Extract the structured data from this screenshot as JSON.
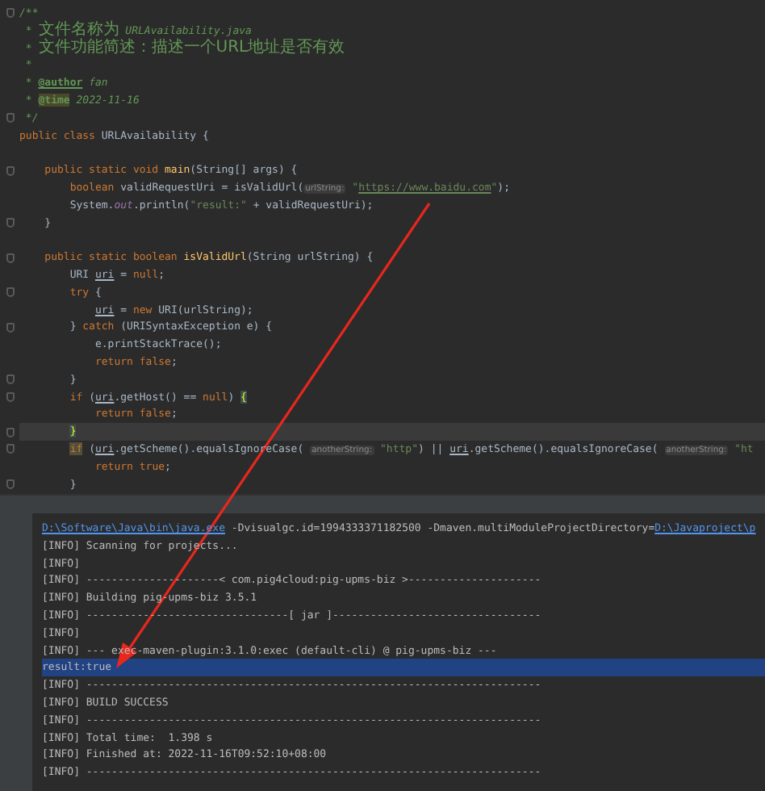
{
  "editor": {
    "lines": [
      {
        "kind": "code",
        "fold": true,
        "segments": [
          {
            "kind": "comment",
            "text": "/**"
          }
        ]
      },
      {
        "kind": "code",
        "segments": [
          {
            "kind": "comment",
            "text": " * "
          },
          {
            "kind": "cjk",
            "text": "文件名称为"
          },
          {
            "kind": "comment",
            "text": " URLAvailability.java"
          }
        ]
      },
      {
        "kind": "code",
        "segments": [
          {
            "kind": "comment",
            "text": " * "
          },
          {
            "kind": "cjk",
            "text": "文件功能简述：描述一个URL地址是否有效"
          }
        ]
      },
      {
        "kind": "code",
        "segments": [
          {
            "kind": "comment",
            "text": " *"
          }
        ]
      },
      {
        "kind": "code",
        "segments": [
          {
            "kind": "comment",
            "text": " * "
          },
          {
            "kind": "doctag",
            "text": "@author"
          },
          {
            "kind": "comment",
            "text": " fan"
          }
        ]
      },
      {
        "kind": "code",
        "segments": [
          {
            "kind": "comment",
            "text": " * "
          },
          {
            "kind": "doctag-hl",
            "text": "@time"
          },
          {
            "kind": "comment",
            "text": " 2022-11-16"
          }
        ]
      },
      {
        "kind": "code",
        "fold": true,
        "segments": [
          {
            "kind": "comment",
            "text": " */"
          }
        ]
      },
      {
        "kind": "code",
        "segments": [
          {
            "kind": "kw",
            "text": "public class "
          },
          {
            "kind": "plain",
            "text": "URLAvailability {"
          }
        ]
      },
      {
        "kind": "blank"
      },
      {
        "kind": "code",
        "fold": true,
        "segments": [
          {
            "kind": "kw",
            "text": "    public static void "
          },
          {
            "kind": "method",
            "text": "main"
          },
          {
            "kind": "plain",
            "text": "(String[] args) {"
          }
        ]
      },
      {
        "kind": "code",
        "segments": [
          {
            "kind": "kw",
            "text": "        boolean "
          },
          {
            "kind": "plain",
            "text": "validRequestUri = isValidUrl("
          },
          {
            "kind": "hint",
            "text": "urlString:"
          },
          {
            "kind": "string",
            "text": " \""
          },
          {
            "kind": "string-link",
            "text": "https://www.baidu.com"
          },
          {
            "kind": "string",
            "text": "\""
          },
          {
            "kind": "plain",
            "text": ");"
          }
        ]
      },
      {
        "kind": "code",
        "segments": [
          {
            "kind": "plain",
            "text": "        System."
          },
          {
            "kind": "static-field",
            "text": "out"
          },
          {
            "kind": "plain",
            "text": ".println("
          },
          {
            "kind": "string",
            "text": "\"result:\""
          },
          {
            "kind": "plain",
            "text": " + validRequestUri);"
          }
        ]
      },
      {
        "kind": "code",
        "fold": true,
        "segments": [
          {
            "kind": "plain",
            "text": "    }"
          }
        ]
      },
      {
        "kind": "blank"
      },
      {
        "kind": "code",
        "fold": true,
        "segments": [
          {
            "kind": "kw",
            "text": "    public static boolean "
          },
          {
            "kind": "method",
            "text": "isValidUrl"
          },
          {
            "kind": "plain",
            "text": "(String urlString) {"
          }
        ]
      },
      {
        "kind": "code",
        "segments": [
          {
            "kind": "plain",
            "text": "        URI "
          },
          {
            "kind": "var-underline",
            "text": "uri"
          },
          {
            "kind": "plain",
            "text": " = "
          },
          {
            "kind": "kw",
            "text": "null"
          },
          {
            "kind": "plain",
            "text": ";"
          }
        ]
      },
      {
        "kind": "code",
        "fold": true,
        "segments": [
          {
            "kind": "kw",
            "text": "        try "
          },
          {
            "kind": "plain",
            "text": "{"
          }
        ]
      },
      {
        "kind": "code",
        "segments": [
          {
            "kind": "var-underline",
            "text": "            uri"
          },
          {
            "kind": "plain",
            "text": " = "
          },
          {
            "kind": "kw",
            "text": "new "
          },
          {
            "kind": "plain",
            "text": "URI(urlString);"
          }
        ]
      },
      {
        "kind": "code",
        "fold": true,
        "segments": [
          {
            "kind": "plain",
            "text": "        } "
          },
          {
            "kind": "kw",
            "text": "catch "
          },
          {
            "kind": "plain",
            "text": "(URISyntaxException e) {"
          }
        ]
      },
      {
        "kind": "code",
        "segments": [
          {
            "kind": "plain",
            "text": "            e.printStackTrace();"
          }
        ]
      },
      {
        "kind": "code",
        "segments": [
          {
            "kind": "kw",
            "text": "            return false"
          },
          {
            "kind": "plain",
            "text": ";"
          }
        ]
      },
      {
        "kind": "code",
        "fold": true,
        "segments": [
          {
            "kind": "plain",
            "text": "        }"
          }
        ]
      },
      {
        "kind": "code",
        "fold": true,
        "segments": [
          {
            "kind": "kw",
            "text": "        if "
          },
          {
            "kind": "plain",
            "text": "("
          },
          {
            "kind": "var-underline",
            "text": "uri"
          },
          {
            "kind": "plain",
            "text": ".getHost() == "
          },
          {
            "kind": "kw",
            "text": "null"
          },
          {
            "kind": "plain",
            "text": ") "
          },
          {
            "kind": "brace-hl",
            "text": "{"
          }
        ]
      },
      {
        "kind": "code",
        "segments": [
          {
            "kind": "kw",
            "text": "            return false"
          },
          {
            "kind": "plain",
            "text": ";"
          }
        ]
      },
      {
        "kind": "code",
        "fold": true,
        "current": true,
        "segments": [
          {
            "kind": "brace-hl",
            "text": "        }"
          }
        ]
      },
      {
        "kind": "code",
        "fold": true,
        "segments": [
          {
            "kind": "kw-hl",
            "text": "        if"
          },
          {
            "kind": "plain",
            "text": " ("
          },
          {
            "kind": "var-underline",
            "text": "uri"
          },
          {
            "kind": "plain",
            "text": ".getScheme().equalsIgnoreCase( "
          },
          {
            "kind": "hint",
            "text": "anotherString:"
          },
          {
            "kind": "string",
            "text": " \"http\""
          },
          {
            "kind": "plain",
            "text": ") || "
          },
          {
            "kind": "var-underline",
            "text": "uri"
          },
          {
            "kind": "plain",
            "text": ".getScheme().equalsIgnoreCase( "
          },
          {
            "kind": "hint",
            "text": "anotherString:"
          },
          {
            "kind": "string",
            "text": " \"ht"
          }
        ]
      },
      {
        "kind": "code",
        "segments": [
          {
            "kind": "kw",
            "text": "            return true"
          },
          {
            "kind": "plain",
            "text": ";"
          }
        ]
      },
      {
        "kind": "code",
        "fold": true,
        "segments": [
          {
            "kind": "plain",
            "text": "        }"
          }
        ]
      }
    ]
  },
  "console": {
    "lines": [
      {
        "selected": false,
        "segments": [
          {
            "kind": "link",
            "text": "D:\\Software\\Java\\bin\\java.exe"
          },
          {
            "kind": "plain",
            "text": " -Dvisualgc.id=1994333371182500 -Dmaven.multiModuleProjectDirectory="
          },
          {
            "kind": "link",
            "text": "D:\\Javaproject\\p"
          }
        ]
      },
      {
        "selected": false,
        "segments": [
          {
            "kind": "plain",
            "text": "[INFO] Scanning for projects..."
          }
        ]
      },
      {
        "selected": false,
        "segments": [
          {
            "kind": "plain",
            "text": "[INFO]"
          }
        ]
      },
      {
        "selected": false,
        "segments": [
          {
            "kind": "plain",
            "text": "[INFO] ---------------------< com.pig4cloud:pig-upms-biz >---------------------"
          }
        ]
      },
      {
        "selected": false,
        "segments": [
          {
            "kind": "plain",
            "text": "[INFO] Building pig-upms-biz 3.5.1"
          }
        ]
      },
      {
        "selected": false,
        "segments": [
          {
            "kind": "plain",
            "text": "[INFO] --------------------------------[ jar ]---------------------------------"
          }
        ]
      },
      {
        "selected": false,
        "segments": [
          {
            "kind": "plain",
            "text": "[INFO]"
          }
        ]
      },
      {
        "selected": false,
        "segments": [
          {
            "kind": "plain",
            "text": "[INFO] --- exec-maven-plugin:3.1.0:exec (default-cli) @ pig-upms-biz ---"
          }
        ]
      },
      {
        "selected": true,
        "segments": [
          {
            "kind": "plain",
            "text": "result:true"
          }
        ]
      },
      {
        "selected": false,
        "segments": [
          {
            "kind": "plain",
            "text": "[INFO] ------------------------------------------------------------------------"
          }
        ]
      },
      {
        "selected": false,
        "segments": [
          {
            "kind": "plain",
            "text": "[INFO] BUILD SUCCESS"
          }
        ]
      },
      {
        "selected": false,
        "segments": [
          {
            "kind": "plain",
            "text": "[INFO] ------------------------------------------------------------------------"
          }
        ]
      },
      {
        "selected": false,
        "segments": [
          {
            "kind": "plain",
            "text": "[INFO] Total time:  1.398 s"
          }
        ]
      },
      {
        "selected": false,
        "segments": [
          {
            "kind": "plain",
            "text": "[INFO] Finished at: 2022-11-16T09:52:10+08:00"
          }
        ]
      },
      {
        "selected": false,
        "segments": [
          {
            "kind": "plain",
            "text": "[INFO] ------------------------------------------------------------------------"
          }
        ]
      }
    ]
  }
}
